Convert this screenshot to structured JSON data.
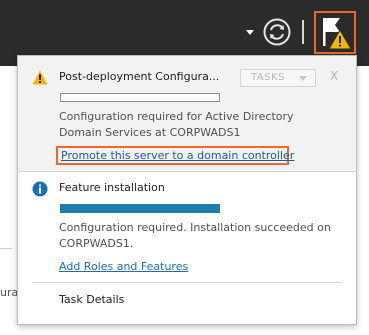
{
  "toolbar": {
    "icons": [
      "chevron-down-icon",
      "refresh-icon",
      "flag-icon",
      "warning-icon"
    ],
    "accent_color": "#e96a2c"
  },
  "background": {
    "partial_text": "urat"
  },
  "notifications": [
    {
      "icon": "warning-icon",
      "title": "Post-deployment Configura...",
      "tasks_label": "TASKS",
      "close_label": "X",
      "progress": 0,
      "description": "Configuration required for Active Directory Domain Services at CORPWADS1",
      "link": "Promote this server to a domain controller"
    },
    {
      "icon": "info-icon",
      "title": "Feature installation",
      "progress": 1.0,
      "description": "Configuration required. Installation succeeded on CORPWADS1.",
      "link": "Add Roles and Features"
    }
  ],
  "footer": {
    "task_details_label": "Task Details"
  }
}
